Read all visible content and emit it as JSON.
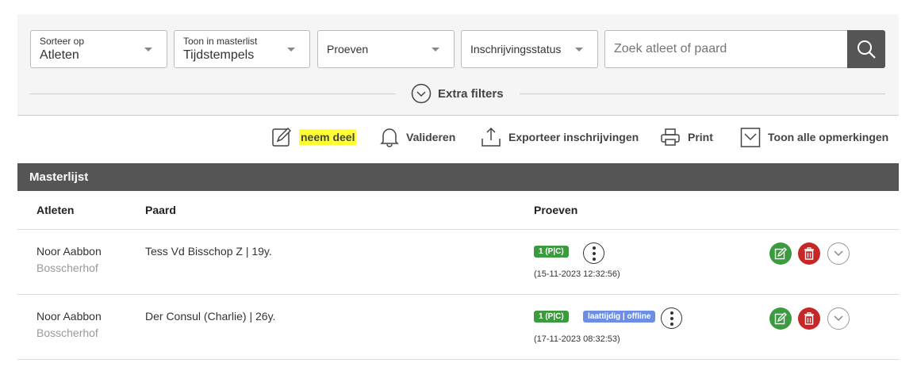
{
  "filters": {
    "sort": {
      "label": "Sorteer op",
      "value": "Atleten"
    },
    "masterlist": {
      "label": "Toon in masterlist",
      "value": "Tijdstempels"
    },
    "proeven": {
      "value": "Proeven"
    },
    "status": {
      "value": "Inschrijvingsstatus"
    },
    "search": {
      "placeholder": "Zoek atleet of paard"
    },
    "extra_filters": "Extra filters"
  },
  "toolbar": {
    "join": "neem deel",
    "validate": "Valideren",
    "export": "Exporteer inschrijvingen",
    "print": "Print",
    "show_remarks": "Toon alle opmerkingen"
  },
  "masterlist": {
    "title": "Masterlijst",
    "columns": {
      "athletes": "Atleten",
      "horse": "Paard",
      "events": "Proeven"
    },
    "rows": [
      {
        "athlete": "Noor Aabbon",
        "stable": "Bosscherhof",
        "horse": "Tess Vd Bisschop Z  | 19y.",
        "event_badge": "1 (P|C)",
        "timestamp": "(15-11-2023 12:32:56)"
      },
      {
        "athlete": "Noor Aabbon",
        "stable": "Bosscherhof",
        "horse": "Der Consul (Charlie)  | 26y.",
        "event_badge": "1 (P|C)",
        "status_badge": "laattijdig | offline",
        "timestamp": "(17-11-2023 08:32:53)"
      }
    ]
  },
  "colors": {
    "header_bg": "#555555",
    "badge_green": "#3c9a3f",
    "badge_blue": "#6c8ee5",
    "delete_red": "#c62828",
    "highlight": "#ffff33"
  }
}
